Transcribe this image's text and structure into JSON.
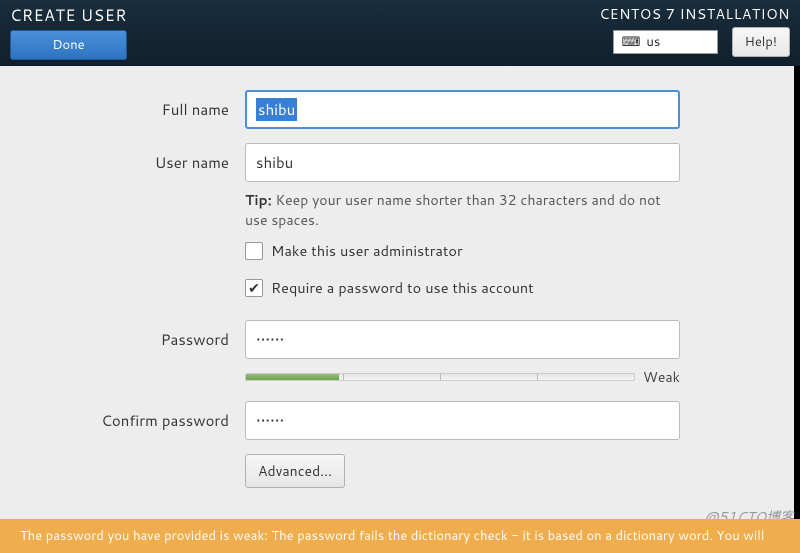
{
  "header": {
    "title": "CREATE USER",
    "subtitle": "CENTOS 7 INSTALLATION",
    "done_label": "Done",
    "help_label": "Help!",
    "kb_layout": "us"
  },
  "form": {
    "fullname_label": "Full name",
    "fullname_value": "shibu",
    "username_label": "User name",
    "username_value": "shibu",
    "tip_prefix": "Tip:",
    "tip_text": " Keep your user name shorter than 32 characters and do not use spaces.",
    "admin_label": "Make this user administrator",
    "require_pw_label": "Require a password to use this account",
    "password_label": "Password",
    "password_value": "••••••",
    "confirm_label": "Confirm password",
    "confirm_value": "••••••",
    "strength_label": "Weak",
    "strength_percent": 24,
    "advanced_label": "Advanced..."
  },
  "footer": {
    "warning": "The password you have provided is weak: The password fails the dictionary check - it is based on a dictionary word. You will"
  },
  "watermark": "@51CTO博客"
}
